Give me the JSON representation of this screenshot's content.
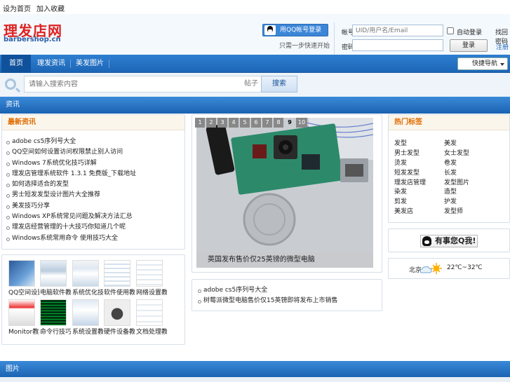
{
  "topbar": {
    "link1": "设为首页",
    "link2": "加入收藏"
  },
  "brand": {
    "name_cn": "理发店网",
    "domain": "barbershop.cn"
  },
  "qq_login": {
    "button": "用QQ帐号登录",
    "sub": "只需一步快速开始"
  },
  "login": {
    "user_label": "帐号",
    "user_placeholder": "UID/用户名/Email",
    "pass_label": "密码",
    "pass_placeholder": "",
    "remember": "自动登录",
    "submit": "登录",
    "register": "注册",
    "lost": "找回密码"
  },
  "nav": {
    "items": [
      "首页",
      "理发资讯",
      "美发图片"
    ],
    "active": 0,
    "select_value": "快捷导航"
  },
  "search": {
    "placeholder": "请输入搜索内容",
    "type": "帖子",
    "button": "搜索"
  },
  "section1": {
    "title": "资讯"
  },
  "news_panel": {
    "title": "最新资讯",
    "items": [
      "adobe cs5序列号大全",
      "QQ空间如何设置访问权限禁止别人访问",
      "Windows 7系统优化技巧详解",
      "理发店管理系统软件 1.3.1 免费版_下载地址",
      "如何选择适合的发型",
      "男士短发发型设计图片大全推荐",
      "美发技巧分享",
      "Windows XP系统常见问题及解决方法汇总",
      "理发店经营管理的十大技巧你知道几个呢",
      "Windows系统常用命令 使用技巧大全"
    ]
  },
  "thumbs": {
    "row1": [
      "QQ空间设置",
      "电脑软件教程",
      "系统优化技巧",
      "软件使用教程",
      "网络设置教程"
    ],
    "row2": [
      "Monitor教程",
      "命令行技巧",
      "系统设置教程",
      "硬件设备教程",
      "文档处理教程"
    ]
  },
  "slider": {
    "pages": [
      "1",
      "2",
      "3",
      "4",
      "5",
      "6",
      "7",
      "8",
      "9",
      "10"
    ],
    "current": 8,
    "caption": "英国发布售价仅25英镑的微型电脑"
  },
  "center_list": {
    "items": [
      "adobe cs5序列号大全",
      "树莓派微型电脑售价仅15英镑即将发布上市销售"
    ]
  },
  "tags_panel": {
    "title": "热门标签",
    "left": [
      "发型",
      "男士发型",
      "烫发",
      "短发发型",
      "理发店管理",
      "染发",
      "剪发",
      "美发店"
    ],
    "right": [
      "美发",
      "女士发型",
      "卷发",
      "长发",
      "发型图片",
      "造型",
      "护发",
      "发型师"
    ]
  },
  "qq_contact": {
    "label": "有事您Q我!"
  },
  "weather": {
    "city": "北京",
    "temp": "22℃~32℃"
  },
  "section2": {
    "title": "图片"
  }
}
